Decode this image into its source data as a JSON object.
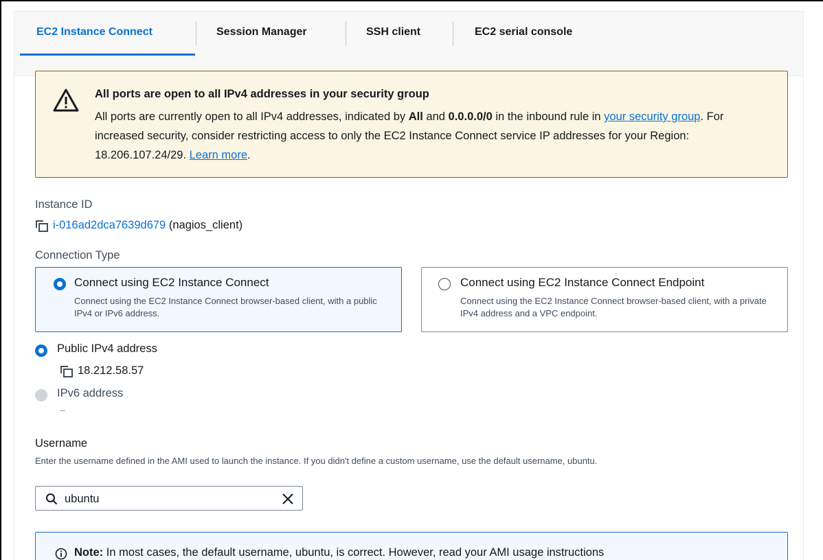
{
  "tabs": [
    {
      "label": "EC2 Instance Connect",
      "active": true
    },
    {
      "label": "Session Manager",
      "active": false
    },
    {
      "label": "SSH client",
      "active": false
    },
    {
      "label": "EC2 serial console",
      "active": false
    }
  ],
  "warning": {
    "title": "All ports are open to all IPv4 addresses in your security group",
    "line1_pre": "All ports are currently open to all IPv4 addresses, indicated by ",
    "bold_all": "All",
    "line1_and": " and ",
    "bold_cidr": "0.0.0.0/0",
    "line1_post": " in the inbound rule in",
    "link_sg": "your security group",
    "line2_post": ". For increased security, consider restricting access to only the EC2 Instance Connect service IP addresses for your Region: 18.206.107.24/29. ",
    "link_learn": "Learn more",
    "end": ".",
    "color": "#fbf5e4",
    "border_color": "#8d6605"
  },
  "instance": {
    "label": "Instance ID",
    "id": "i-016ad2dca7639d679",
    "name": "(nagios_client)"
  },
  "connection_type": {
    "label": "Connection Type",
    "options": [
      {
        "title": "Connect using EC2 Instance Connect",
        "description": "Connect using the EC2 Instance Connect browser-based client, with a public IPv4 or IPv6 address.",
        "selected": true
      },
      {
        "title": "Connect using EC2 Instance Connect Endpoint",
        "description": "Connect using the EC2 Instance Connect browser-based client, with a private IPv4 address and a VPC endpoint.",
        "selected": false
      }
    ]
  },
  "address": {
    "public_label": "Public IPv4 address",
    "public_value": "18.212.58.57",
    "ipv6_label": "IPv6 address",
    "ipv6_value": "–"
  },
  "username": {
    "label": "Username",
    "description": "Enter the username defined in the AMI used to launch the instance. If you didn't define a custom username, use the default username, ubuntu.",
    "value": "ubuntu"
  },
  "note": {
    "bold": "Note:",
    "text": " In most cases, the default username, ubuntu, is correct. However, read your AMI usage instructions"
  },
  "icons": {
    "warning": "warning-triangle-icon",
    "copy": "copy-icon",
    "search": "search-icon",
    "clear": "close-icon",
    "info": "info-icon"
  },
  "colors": {
    "accent": "#0972d3",
    "text": "#16191f",
    "muted": "#414d5c"
  }
}
